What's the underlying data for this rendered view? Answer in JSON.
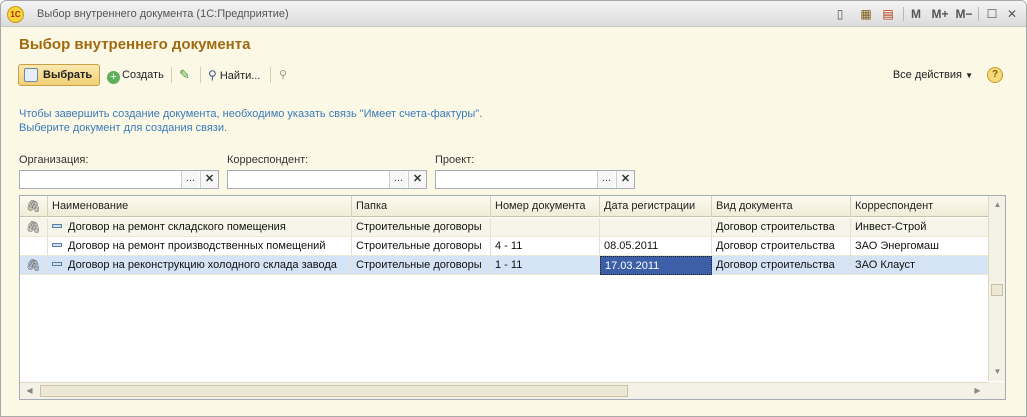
{
  "window": {
    "title": "Выбор внутреннего документа  (1С:Предприятие)",
    "logo": "1С",
    "controls": {
      "m": "M",
      "m_plus": "M+",
      "m_minus": "M−",
      "close": "✕"
    }
  },
  "form": {
    "title": "Выбор внутреннего документа"
  },
  "toolbar": {
    "select_label": "Выбрать",
    "create_label": "Создать",
    "find_label": "Найти...",
    "all_actions_label": "Все действия",
    "help_label": "?"
  },
  "info": {
    "line1": "Чтобы завершить создание документа, необходимо указать связь \"Имеет счета-фактуры\".",
    "line2": "Выберите документ для создания связи."
  },
  "filters": {
    "organization": {
      "label": "Организация:",
      "value": ""
    },
    "correspondent": {
      "label": "Корреспондент:",
      "value": ""
    },
    "project": {
      "label": "Проект:",
      "value": ""
    },
    "select_button": "...",
    "clear_button": "✕"
  },
  "table": {
    "columns": [
      "Наименование",
      "Папка",
      "Номер документа",
      "Дата регистрации",
      "Вид документа",
      "Корреспондент"
    ],
    "rows": [
      {
        "attached": true,
        "name": "Договор на ремонт складского помещения",
        "folder": "Строительные договоры",
        "number": "",
        "date": "",
        "type": "Договор строительства",
        "correspondent": "Инвест-Строй"
      },
      {
        "attached": false,
        "name": "Договор на ремонт производственных помещений",
        "folder": "Строительные договоры",
        "number": "4 - 11",
        "date": "08.05.2011",
        "type": "Договор строительства",
        "correspondent": "ЗАО Энергомаш"
      },
      {
        "attached": true,
        "name": "Договор на реконструкцию холодного склада завода",
        "folder": "Строительные договоры",
        "number": "1 - 11",
        "date": "17.03.2011",
        "type": "Договор строительства",
        "correspondent": "ЗАО Клауст"
      }
    ],
    "selected_row": 2
  },
  "colors": {
    "title": "#a06a10",
    "info": "#3b7ab8",
    "selection": "#d4e3f5",
    "focus_cell": "#3d5fa8"
  }
}
